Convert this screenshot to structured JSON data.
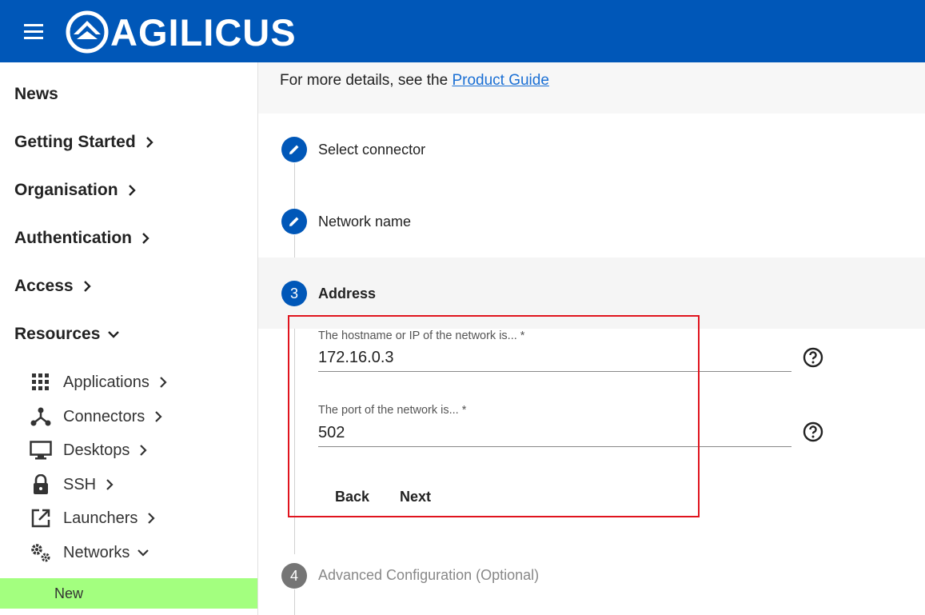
{
  "header": {
    "logo_text": "AGILICUS",
    "brand_color": "#0057b8"
  },
  "sidebar": {
    "items": [
      {
        "label": "News"
      },
      {
        "label": "Getting Started"
      },
      {
        "label": "Organisation"
      },
      {
        "label": "Authentication"
      },
      {
        "label": "Access"
      },
      {
        "label": "Resources"
      }
    ],
    "resources": [
      {
        "label": "Applications",
        "icon": "grid-icon"
      },
      {
        "label": "Connectors",
        "icon": "connector-icon"
      },
      {
        "label": "Desktops",
        "icon": "monitor-icon"
      },
      {
        "label": "SSH",
        "icon": "lock-icon"
      },
      {
        "label": "Launchers",
        "icon": "launch-icon"
      },
      {
        "label": "Networks",
        "icon": "gears-icon"
      }
    ],
    "selected": {
      "label": "New",
      "color": "#a3ff7f"
    }
  },
  "main": {
    "details_prefix": "For more details, see the",
    "details_link": "Product Guide",
    "steps": [
      {
        "number": "",
        "label": "Select connector",
        "state": "done"
      },
      {
        "number": "",
        "label": "Network name",
        "state": "done"
      },
      {
        "number": "3",
        "label": "Address",
        "state": "active"
      },
      {
        "number": "4",
        "label": "Advanced Configuration (Optional)",
        "state": "pending"
      }
    ],
    "form": {
      "hostname_label": "The hostname or IP of the network is... *",
      "hostname_value": "172.16.0.3",
      "port_label": "The port of the network is... *",
      "port_value": "502",
      "back_label": "Back",
      "next_label": "Next"
    }
  },
  "colors": {
    "step_active": "#0057b8",
    "step_pending": "#757575",
    "highlight": "#e0141e"
  }
}
